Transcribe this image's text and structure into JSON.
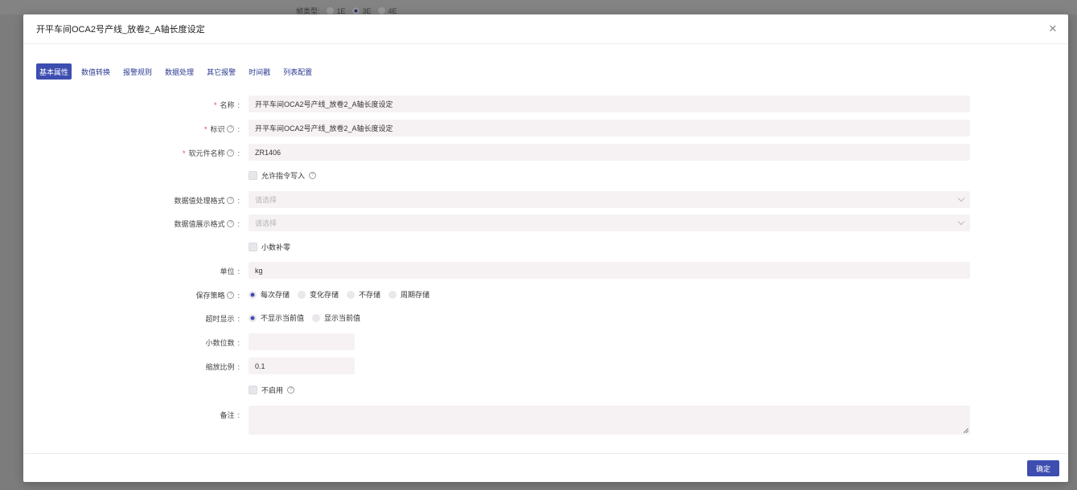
{
  "background": {
    "radio_label": "帧类型:",
    "radio_options": [
      "1E",
      "3E",
      "4E"
    ],
    "selected": "3E"
  },
  "dialog": {
    "title": "开平车间OCA2号产线_放卷2_A轴长度设定",
    "close_icon": "close-icon"
  },
  "tabs": [
    {
      "label": "基本属性",
      "active": true
    },
    {
      "label": "数值转换",
      "active": false
    },
    {
      "label": "报警规则",
      "active": false
    },
    {
      "label": "数据处理",
      "active": false
    },
    {
      "label": "其它报警",
      "active": false
    },
    {
      "label": "时间戳",
      "active": false
    },
    {
      "label": "列表配置",
      "active": false
    }
  ],
  "form": {
    "name": {
      "label": "名称",
      "required": true,
      "value": "开平车间OCA2号产线_放卷2_A轴长度设定"
    },
    "identifier": {
      "label": "标识",
      "required": true,
      "help": true,
      "value": "开平车间OCA2号产线_放卷2_A轴长度设定"
    },
    "soft_element": {
      "label": "软元件名称",
      "required": true,
      "help": true,
      "value": "ZR1406"
    },
    "allow_write": {
      "label": "允许指令写入",
      "checked": false,
      "help": true
    },
    "process_format": {
      "label": "数据值处理格式",
      "help": true,
      "placeholder": "请选择"
    },
    "display_format": {
      "label": "数据值展示格式",
      "help": true,
      "placeholder": "请选择"
    },
    "zero_pad": {
      "label": "小数补零",
      "checked": false
    },
    "unit": {
      "label": "单位",
      "value": "kg"
    },
    "save_strategy": {
      "label": "保存策略",
      "help": true,
      "options": [
        "每次存储",
        "变化存储",
        "不存储",
        "周期存储"
      ],
      "selected": "每次存储"
    },
    "timeout_display": {
      "label": "超时显示",
      "options": [
        "不显示当前值",
        "显示当前值"
      ],
      "selected": "不显示当前值"
    },
    "decimals": {
      "label": "小数位数",
      "value": ""
    },
    "scale": {
      "label": "缩放比例",
      "value": "0.1"
    },
    "disabled": {
      "label": "不启用",
      "checked": false,
      "help": true
    },
    "remark": {
      "label": "备注",
      "value": ""
    }
  },
  "footer": {
    "ok_label": "确定"
  },
  "colors": {
    "accent": "#3d4db0",
    "required": "#e0443b",
    "input_bg": "#f6f2f4"
  }
}
